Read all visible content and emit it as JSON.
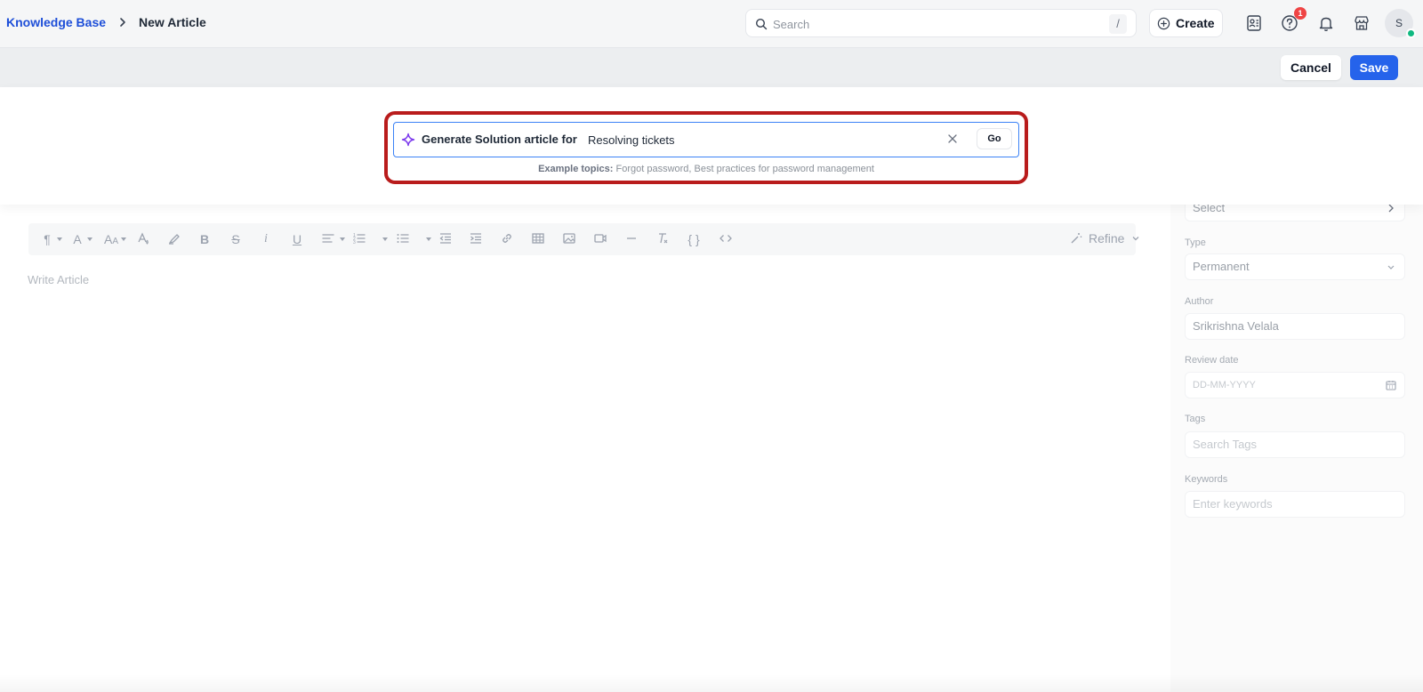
{
  "header": {
    "breadcrumb": {
      "root": "Knowledge Base",
      "current": "New Article"
    },
    "search": {
      "placeholder": "Search",
      "shortcut": "/"
    },
    "create_label": "Create",
    "help_badge_count": "1",
    "avatar_initial": "S",
    "icons": [
      "contact-card-icon",
      "help-icon",
      "bell-icon",
      "store-icon"
    ]
  },
  "actions": {
    "cancel_label": "Cancel",
    "save_label": "Save"
  },
  "generator": {
    "label": "Generate Solution article for",
    "value": "Resolving tickets",
    "go_label": "Go",
    "examples_prefix": "Example topics:",
    "examples_text": "Forgot password, Best practices for password management",
    "accent_color": "#7c3aed",
    "highlight_color": "#b91c1c"
  },
  "editor": {
    "placeholder": "Write Article",
    "refine_label": "Refine"
  },
  "sidebar": {
    "select_value": "Select",
    "type_label": "Type",
    "type_value": "Permanent",
    "author_label": "Author",
    "author_value": "Srikrishna Velala",
    "review_label": "Review date",
    "review_placeholder": "DD-MM-YYYY",
    "tags_label": "Tags",
    "tags_placeholder": "Search Tags",
    "keywords_label": "Keywords",
    "keywords_placeholder": "Enter keywords"
  },
  "colors": {
    "primary": "#2563eb",
    "link": "#1d4ed8",
    "presence": "#10b981",
    "badge": "#ef4444"
  }
}
